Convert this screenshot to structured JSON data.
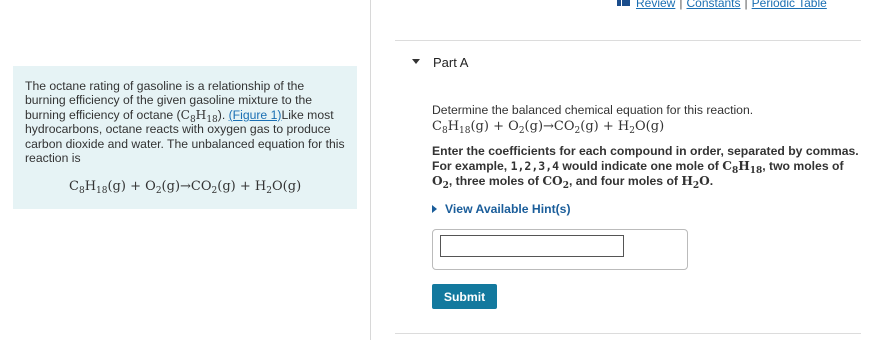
{
  "top_links": {
    "review_icon": "book-icon",
    "review": "Review",
    "separator": "|",
    "constants": "Constants",
    "periodic_table": "Periodic Table"
  },
  "problem": {
    "text_before_link": "The octane rating of gasoline is a relationship of the burning efficiency of the given gasoline mixture to the burning efficiency of octane (",
    "octane_formula": {
      "c": "C",
      "c_sub": "8",
      "h": "H",
      "h_sub": "18"
    },
    "text_after_formula": "). ",
    "figure_link": "(Figure 1)",
    "text_after_link": "Like most hydrocarbons, octane reacts with oxygen gas to produce carbon dioxide and water. The unbalanced equation for this reaction is"
  },
  "equation": {
    "c8h18": {
      "c": "C",
      "c_sub": "8",
      "h": "H",
      "h_sub": "18"
    },
    "o2": {
      "o": "O",
      "sub": "2"
    },
    "co2": {
      "c": "CO",
      "sub": "2"
    },
    "h2o": {
      "h": "H",
      "sub": "2",
      "o": "O"
    },
    "state": "(g)",
    "plus": "+",
    "arrow": "→"
  },
  "part": {
    "title": "Part A",
    "question": "Determine the balanced chemical equation for this reaction.",
    "instructions_1": "Enter the coefficients for each compound in order, separated by commas. For example, ",
    "example_code": "1,2,3,4",
    "instructions_2": " would indicate one mole of ",
    "instructions_3": ", two moles of ",
    "instructions_4": ", three moles of ",
    "instructions_5": ", and four moles of ",
    "instructions_6": ".",
    "hint_label": "View Available Hint(s)",
    "answer_value": "",
    "submit_label": "Submit"
  },
  "colors": {
    "link": "#1a6fb3",
    "problem_bg": "#e6f3f5",
    "submit_bg": "#13799e"
  }
}
